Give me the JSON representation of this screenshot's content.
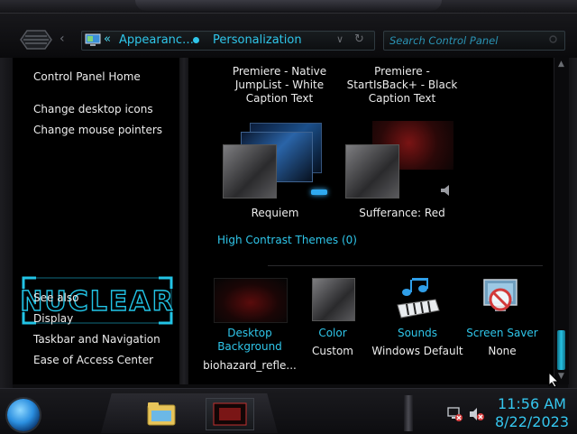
{
  "address": {
    "segment1": "Appearanc…",
    "segment2": "Personalization"
  },
  "search": {
    "placeholder": "Search Control Panel"
  },
  "sidebar": {
    "links": [
      "Control Panel Home",
      "Change desktop icons",
      "Change mouse pointers"
    ],
    "see_also_title": "See also",
    "see_also": [
      "Display",
      "Taskbar and Navigation",
      "Ease of Access Center"
    ],
    "brand": "NUCLEAR"
  },
  "themes": {
    "top_row": [
      {
        "label": "Premiere - Native\nJumpList - White\nCaption Text"
      },
      {
        "label": "Premiere -\nStartIsBack+ - Black\nCaption Text"
      }
    ],
    "row2": [
      {
        "label": "Requiem"
      },
      {
        "label": "Sufferance: Red"
      }
    ],
    "high_contrast_link": "High Contrast Themes (0)"
  },
  "settings": [
    {
      "title": "Desktop\nBackground",
      "value": "biohazard_refle...",
      "icon": "desktop-background-icon"
    },
    {
      "title": "Color",
      "value": "Custom",
      "icon": "color-icon"
    },
    {
      "title": "Sounds",
      "value": "Windows Default",
      "icon": "sounds-icon"
    },
    {
      "title": "Screen Saver",
      "value": "None",
      "icon": "screen-saver-icon"
    }
  ],
  "clock": {
    "time": "11:56 AM",
    "date": "8/22/2023"
  },
  "colors": {
    "accent": "#2fc6ea",
    "background": "#000000",
    "text": "#ececec"
  }
}
